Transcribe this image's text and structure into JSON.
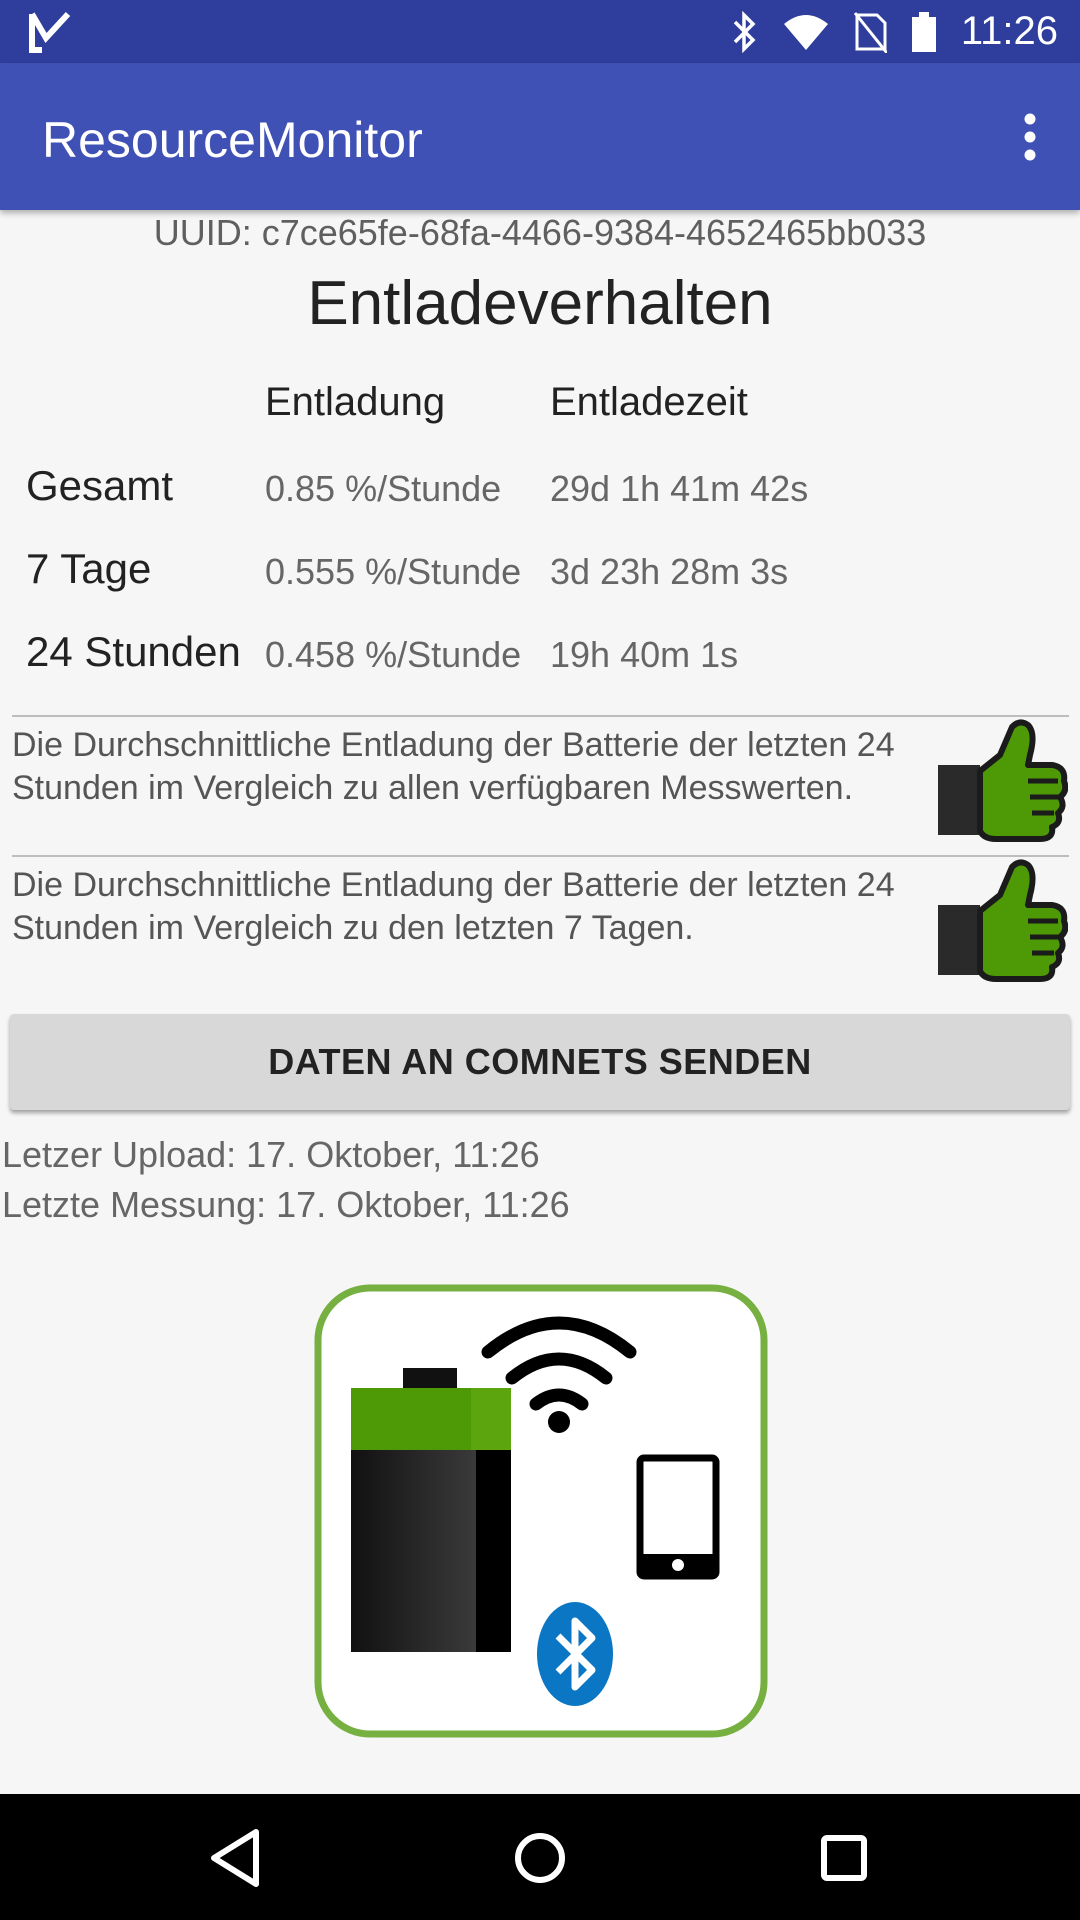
{
  "status": {
    "time": "11:26"
  },
  "app": {
    "title": "ResourceMonitor"
  },
  "uuid": "UUID: c7ce65fe-68fa-4466-9384-4652465bb033",
  "heading": "Entladeverhalten",
  "table": {
    "headers": [
      "Entladung",
      "Entladezeit"
    ],
    "rows": [
      {
        "label": "Gesamt",
        "rate": "0.85 %/Stunde",
        "time": "29d 1h 41m 42s"
      },
      {
        "label": "7 Tage",
        "rate": "0.555 %/Stunde",
        "time": "3d 23h 28m 3s"
      },
      {
        "label": "24 Stunden",
        "rate": "0.458 %/Stunde",
        "time": "19h 40m 1s"
      }
    ]
  },
  "comparisons": [
    {
      "text": "Die Durchschnittliche Entladung der Batterie der letzten 24 Stunden im Vergleich zu allen verfügbaren Messwerten.",
      "icon": "thumbs-up-icon"
    },
    {
      "text": "Die Durchschnittliche Entladung der Batterie der letzten 24 Stunden im Vergleich zu den letzten 7 Tagen.",
      "icon": "thumbs-up-icon"
    }
  ],
  "send_button": "DATEN AN COMNETS SENDEN",
  "info": {
    "last_upload": "Letzer Upload: 17. Oktober, 11:26",
    "last_measure": "Letzte Messung: 17. Oktober, 11:26"
  },
  "colors": {
    "statusbar": "#2f3e9d",
    "appbar": "#3f51b5",
    "thumb_green": "#4e9a06",
    "logo_border": "#76b041",
    "bluetooth_blue": "#0a76c4"
  }
}
